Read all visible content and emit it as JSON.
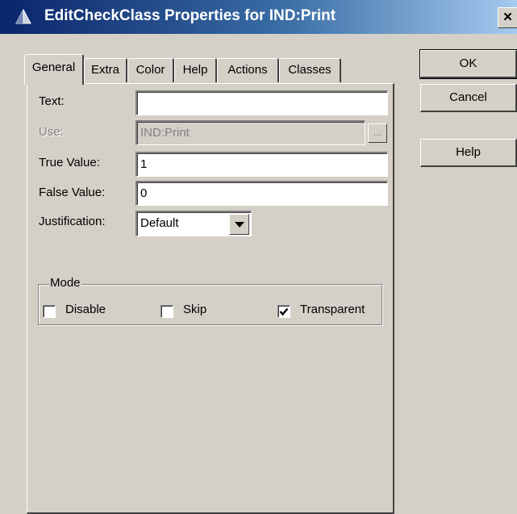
{
  "window": {
    "title": "EditCheckClass Properties for IND:Print",
    "close_label": "×"
  },
  "tabs": [
    "General",
    "Extra",
    "Color",
    "Help",
    "Actions",
    "Classes"
  ],
  "general": {
    "text_label": "Text:",
    "text_value": "",
    "use_label": "Use:",
    "use_value": "IND:Print",
    "browse_label": "...",
    "true_value_label": "True Value:",
    "true_value": "1",
    "false_value_label": "False Value:",
    "false_value": "0",
    "justification_label": "Justification:",
    "justification_value": "Default",
    "mode": {
      "label": "Mode",
      "disable": {
        "label": "Disable",
        "checked": false
      },
      "skip": {
        "label": "Skip",
        "checked": false
      },
      "transparent": {
        "label": "Transparent",
        "checked": true
      }
    }
  },
  "buttons": {
    "ok": "OK",
    "cancel": "Cancel",
    "help": "Help"
  },
  "icons": {
    "title": "compass-app-icon",
    "dropdown": "chevron-down-icon",
    "check": "checkmark-icon"
  }
}
